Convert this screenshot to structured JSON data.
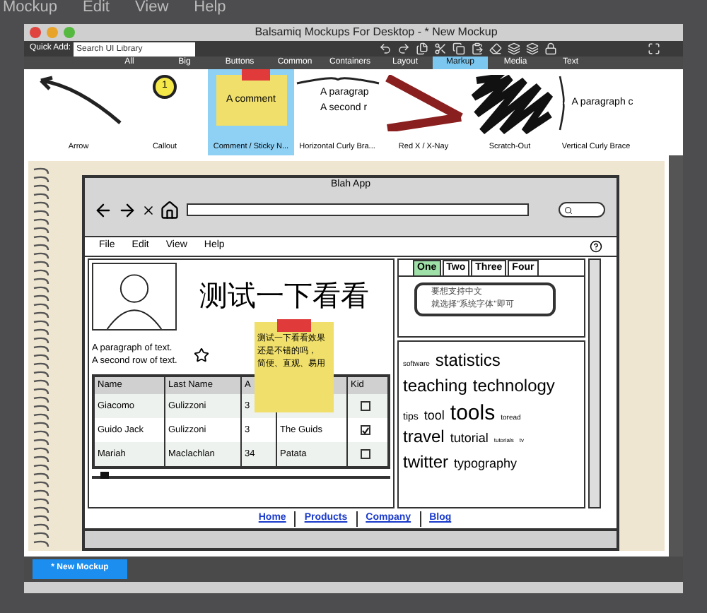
{
  "desktop_menu": [
    "Mockup",
    "Edit",
    "View",
    "Help"
  ],
  "window": {
    "title": "Balsamiq Mockups For Desktop - * New Mockup"
  },
  "quick_add": {
    "label": "Quick Add:",
    "placeholder": "Search UI Library"
  },
  "categories": [
    {
      "label": "All",
      "selected": false
    },
    {
      "label": "Big",
      "selected": false
    },
    {
      "label": "Buttons",
      "selected": false
    },
    {
      "label": "Common",
      "selected": false
    },
    {
      "label": "Containers",
      "selected": false
    },
    {
      "label": "Layout",
      "selected": false
    },
    {
      "label": "Markup",
      "selected": true
    },
    {
      "label": "Media",
      "selected": false
    },
    {
      "label": "Text",
      "selected": false
    }
  ],
  "library": [
    {
      "kind": "arrow",
      "label": "Arrow",
      "selected": false
    },
    {
      "kind": "callout",
      "label": "Callout",
      "preview": [
        "1"
      ],
      "selected": false
    },
    {
      "kind": "sticky",
      "label": "Comment / Sticky N...",
      "preview": [
        "A comment"
      ],
      "selected": true
    },
    {
      "kind": "hbrace",
      "label": "Horizontal Curly Bra...",
      "preview": [
        "A paragrap",
        "A second r"
      ],
      "selected": false
    },
    {
      "kind": "redx",
      "label": "Red X / X-Nay",
      "selected": false
    },
    {
      "kind": "scratch",
      "label": "Scratch-Out",
      "selected": false
    },
    {
      "kind": "vbrace",
      "label": "Vertical Curly Brace",
      "preview": [
        "A paragraph c"
      ],
      "selected": false
    }
  ],
  "mockup": {
    "title": "Blah App",
    "menu": [
      "File",
      "Edit",
      "View",
      "Help"
    ],
    "heading": "测试一下看看",
    "paragraph": [
      "A paragraph of text.",
      "A second row of text."
    ],
    "table": {
      "columns": [
        "Name",
        "Last Name",
        "A",
        "Kid"
      ],
      "rows": [
        {
          "cells": [
            "Giacomo",
            "Gulizzoni",
            "3"
          ],
          "checked": false
        },
        {
          "cells": [
            "Guido Jack",
            "Gulizzoni",
            "3",
            "The Guids"
          ],
          "checked": true
        },
        {
          "cells": [
            "Mariah",
            "Maclachlan",
            "34",
            "Patata"
          ],
          "checked": false
        }
      ]
    },
    "slider": {
      "level": 0.03
    },
    "sticky_note": [
      "测试一下看看效果",
      "还是不错的吗，",
      "简便、直观、易用"
    ],
    "tabs": [
      {
        "label": "One",
        "selected": true
      },
      {
        "label": "Two",
        "selected": false
      },
      {
        "label": "Three",
        "selected": false
      },
      {
        "label": "Four",
        "selected": false
      }
    ],
    "tooltip": [
      "要想支持中文",
      "就选择\"系统字体\"即可"
    ],
    "tag_lines": [
      [
        {
          "text": "software",
          "kind": "xs"
        },
        {
          "text": "statistics",
          "kind": "lg"
        }
      ],
      [
        {
          "text": "teaching",
          "kind": "lg"
        },
        {
          "text": "technology",
          "kind": "lg"
        }
      ],
      [
        {
          "text": "tips",
          "kind": "sm"
        },
        {
          "text": "tool",
          "kind": "md"
        },
        {
          "text": "tools",
          "kind": "xl"
        },
        {
          "text": "toread",
          "kind": "xs"
        }
      ],
      [
        {
          "text": "travel",
          "kind": "lg"
        },
        {
          "text": "tutorial",
          "kind": "md"
        },
        {
          "text": "tutorials",
          "kind": "xxs"
        },
        {
          "text": "tv",
          "kind": "xxs"
        }
      ],
      [
        {
          "text": "twitter",
          "kind": "lg"
        },
        {
          "text": "typography",
          "kind": "md"
        }
      ]
    ],
    "links": [
      "Home",
      "Products",
      "Company",
      "Blog"
    ]
  },
  "new_mockup_tab": "* New Mockup"
}
